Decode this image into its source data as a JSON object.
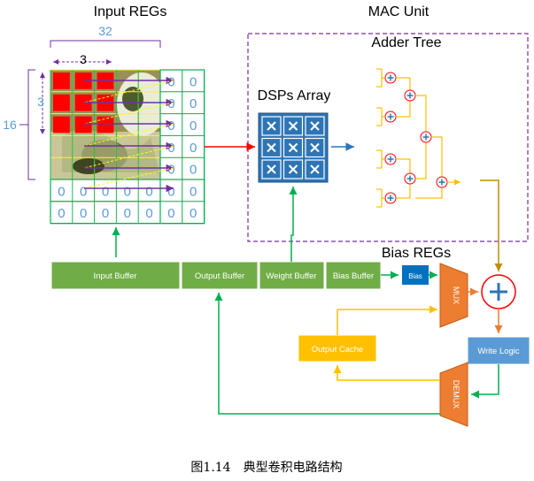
{
  "titles": {
    "input_regs": "Input REGs",
    "mac_unit": "MAC Unit",
    "adder_tree": "Adder Tree",
    "dsps_array": "DSPs Array",
    "bias_regs": "Bias REGs"
  },
  "dimensions": {
    "width_label": "32",
    "kernel_width_label": "3",
    "kernel_height_label": "3",
    "height_label": "16"
  },
  "grid": {
    "zero_value": "0"
  },
  "buffers": {
    "input": "Input Buffer",
    "output": "Output Buffer",
    "weight": "Weight Buffer",
    "bias": "Bias Buffer"
  },
  "blocks": {
    "bias_small": "Bias",
    "mux": "MUX",
    "demux": "DEMUX",
    "output_cache": "Output Cache",
    "write_logic": "Write Logic"
  },
  "caption": "图1.14　典型卷积电路结构",
  "colors": {
    "green": "#70ad47",
    "dark_green": "#538135",
    "blue": "#2e75b6",
    "orange": "#ed7d31",
    "gold": "#ffc000",
    "purple": "#7030a0",
    "red": "#ff0000",
    "arrow_green": "#00b050",
    "label_blue": "#5b9bd5"
  }
}
